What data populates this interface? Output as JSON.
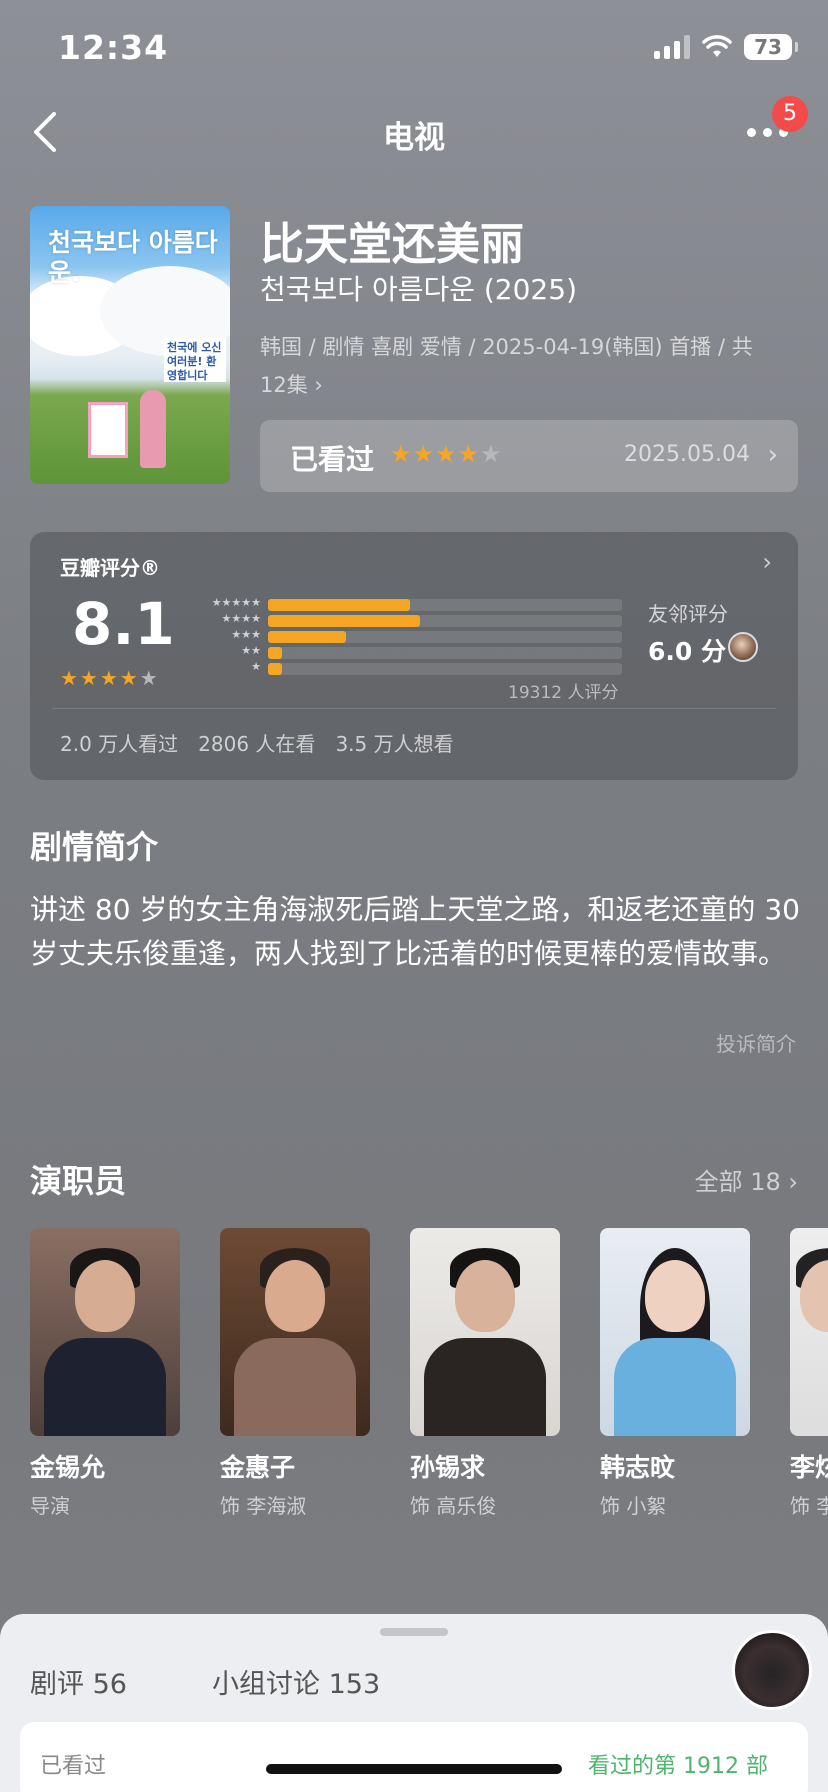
{
  "status": {
    "time": "12:34",
    "battery": "73"
  },
  "nav": {
    "title": "电视",
    "badge": "5"
  },
  "movie": {
    "title": "比天堂还美丽",
    "subtitle": "천국보다 아름다운 (2025)",
    "meta": "韩国 / 剧情 喜剧 爱情 / 2025-04-19(韩国) 首播 / 共 12集",
    "poster_title": "천국보다 아름다운.",
    "poster_sign": "천국에 오신 여러분! 환영합니다"
  },
  "watched": {
    "label": "已看过",
    "stars": 4,
    "date": "2025.05.04"
  },
  "rating": {
    "label": "豆瓣评分®",
    "score": "8.1",
    "stars": 4,
    "distribution": [
      {
        "stars": "★★★★★",
        "value": 0.4
      },
      {
        "stars": "★★★★",
        "value": 0.43
      },
      {
        "stars": "★★★",
        "value": 0.22
      },
      {
        "stars": "★★",
        "value": 0.04
      },
      {
        "stars": "★",
        "value": 0.04
      }
    ],
    "count": "19312 人评分",
    "friend_label": "友邻评分",
    "friend_score": "6.0 分",
    "stat_watched": "2.0 万人看过",
    "stat_watching": "2806 人在看",
    "stat_want": "3.5 万人想看"
  },
  "synopsis": {
    "title": "剧情简介",
    "text": "讲述 80 岁的女主角海淑死后踏上天堂之路，和返老还童的 30 岁丈夫乐俊重逢，两人找到了比活着的时候更棒的爱情故事。",
    "report": "投诉简介"
  },
  "cast": {
    "title": "演职员",
    "all": "全部 18",
    "people": [
      {
        "name": "金锡允",
        "role": "导演"
      },
      {
        "name": "金惠子",
        "role": "饰 李海淑"
      },
      {
        "name": "孙锡求",
        "role": "饰 高乐俊"
      },
      {
        "name": "韩志旼",
        "role": "饰 小絮"
      },
      {
        "name": "李炫",
        "role": "饰 李"
      }
    ]
  },
  "sheet": {
    "tab_reviews": "剧评 56",
    "tab_groups": "小组讨论 153",
    "row_left": "已看过",
    "row_right": "看过的第 1912 部"
  },
  "colors": {
    "accent_star": "#f5a623",
    "badge": "#f34a4a"
  }
}
